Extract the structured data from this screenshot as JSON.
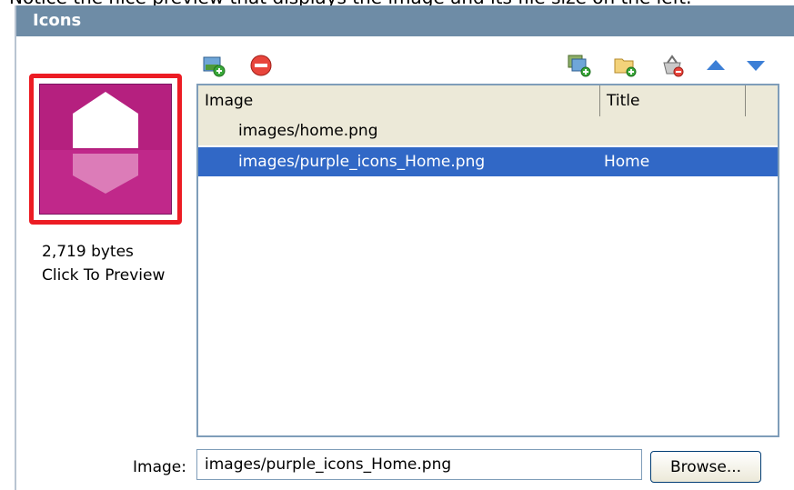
{
  "caption": "Notice the nice preview that displays the image and its file size on the left.",
  "panel": {
    "title": "Icons"
  },
  "preview": {
    "size_text": "2,719 bytes",
    "link_text": "Click To Preview",
    "highlight_color": "#ec1c24",
    "icon_color": "#c8288e"
  },
  "toolbar": {
    "left": [
      {
        "icon": "add-image-icon"
      },
      {
        "icon": "remove-icon"
      }
    ],
    "right": [
      {
        "icon": "add-images-icon"
      },
      {
        "icon": "add-folder-icon"
      },
      {
        "icon": "clear-basket-icon"
      },
      {
        "icon": "move-up-icon"
      },
      {
        "icon": "move-down-icon"
      }
    ]
  },
  "list": {
    "columns": [
      "Image",
      "Title"
    ],
    "rows": [
      {
        "image": "images/home.png",
        "title": ""
      },
      {
        "image": "images/purple_icons_Home.png",
        "title": "Home",
        "selected": true
      }
    ]
  },
  "image_field": {
    "label": "Image:",
    "value": "images/purple_icons_Home.png",
    "browse_label": "Browse..."
  },
  "colors": {
    "header_bg": "#6e8ca6",
    "selection": "#3168c6",
    "alt_row": "#ece9d8"
  }
}
